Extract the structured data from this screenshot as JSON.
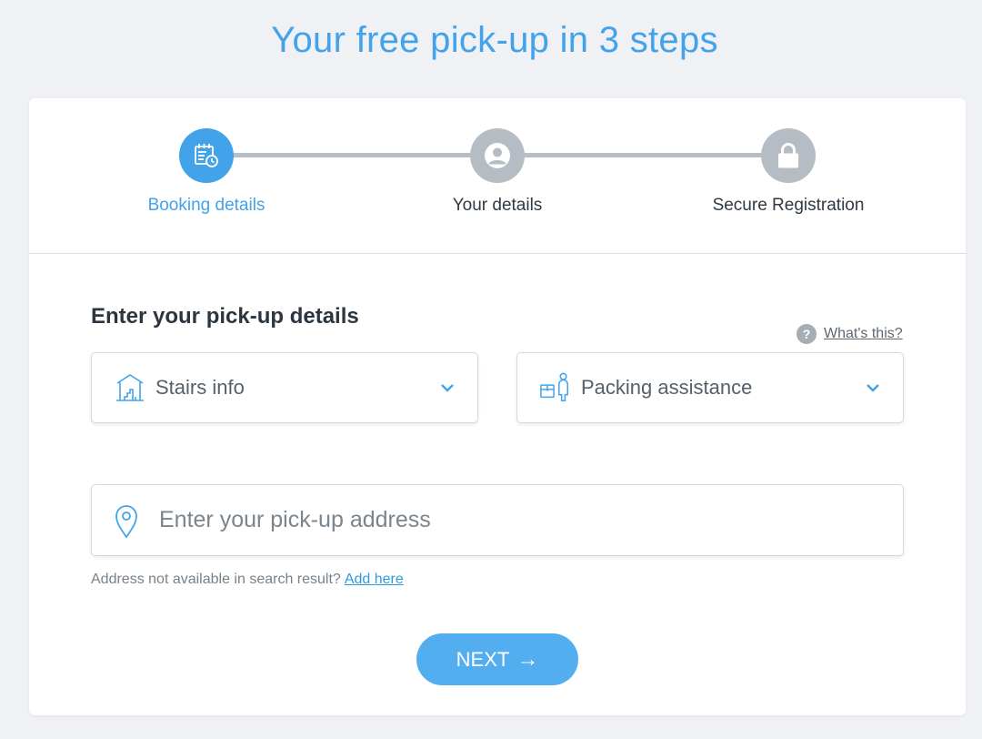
{
  "page": {
    "title": "Your free pick-up in 3 steps"
  },
  "colors": {
    "accent": "#42a3ea",
    "inactive": "#b5bcc3",
    "button": "#53aef0"
  },
  "stepper": {
    "steps": [
      {
        "label": "Booking details",
        "icon": "calendar-clock-icon",
        "active": true
      },
      {
        "label": "Your details",
        "icon": "user-icon",
        "active": false
      },
      {
        "label": "Secure Registration",
        "icon": "lock-icon",
        "active": false
      }
    ]
  },
  "form": {
    "section_title": "Enter your pick-up details",
    "help_link": "What's this?",
    "stairs_select": {
      "label": "Stairs info",
      "icon": "stairs-icon"
    },
    "packing_select": {
      "label": "Packing assistance",
      "icon": "packing-assistance-icon"
    },
    "address": {
      "placeholder": "Enter your pick-up address",
      "icon": "location-pin-icon"
    },
    "hint": {
      "text": "Address not available in search result?",
      "link": "Add here"
    },
    "next_button": {
      "label": "NEXT",
      "icon": "arrow-right-icon"
    }
  }
}
